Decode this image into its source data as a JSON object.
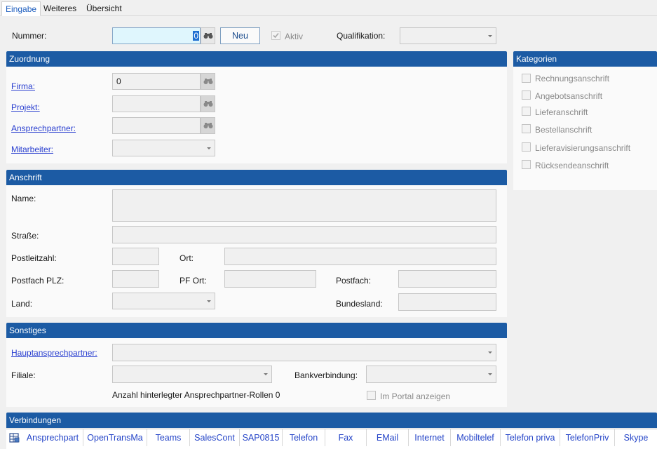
{
  "tabs": [
    {
      "label": "Eingabe"
    },
    {
      "label": "Weiteres"
    },
    {
      "label": "Übersicht"
    }
  ],
  "top": {
    "nummer_label": "Nummer:",
    "nummer_value": "0",
    "neu_label": "Neu",
    "aktiv_label": "Aktiv",
    "aktiv_checked": true,
    "qualifikation_label": "Qualifikation:",
    "qualifikation_value": ""
  },
  "zuordnung": {
    "title": "Zuordnung",
    "firma_label": "Firma:",
    "firma_value": "0",
    "projekt_label": "Projekt:",
    "projekt_value": "",
    "ansprechpartner_label": "Ansprechpartner:",
    "ansprechpartner_value": "",
    "mitarbeiter_label": "Mitarbeiter:",
    "mitarbeiter_value": ""
  },
  "kategorien": {
    "title": "Kategorien",
    "items": [
      {
        "label": "Rechnungsanschrift",
        "checked": false
      },
      {
        "label": "Angebotsanschrift",
        "checked": false
      },
      {
        "label": "Lieferanschrift",
        "checked": false
      },
      {
        "label": "Bestellanschrift",
        "checked": false
      },
      {
        "label": "Lieferavisierungsanschrift",
        "checked": false
      },
      {
        "label": "Rücksendeanschrift",
        "checked": false
      }
    ]
  },
  "anschrift": {
    "title": "Anschrift",
    "name_label": "Name:",
    "strasse_label": "Straße:",
    "plz_label": "Postleitzahl:",
    "ort_label": "Ort:",
    "pf_plz_label": "Postfach PLZ:",
    "pf_ort_label": "PF Ort:",
    "postfach_label": "Postfach:",
    "land_label": "Land:",
    "bundesland_label": "Bundesland:"
  },
  "sonstiges": {
    "title": "Sonstiges",
    "hauptansprechpartner_label": "Hauptansprechpartner:",
    "filiale_label": "Filiale:",
    "bankverbindung_label": "Bankverbindung:",
    "anzahl_text": "Anzahl hinterlegter Ansprechpartner-Rollen 0",
    "im_portal_label": "Im Portal anzeigen"
  },
  "verbindungen": {
    "title": "Verbindungen",
    "columns": [
      "Ansprechpart",
      "OpenTransMa",
      "Teams",
      "SalesCont",
      "SAP0815",
      "Telefon",
      "Fax",
      "EMail",
      "Internet",
      "Mobiltelef",
      "Telefon priva",
      "TelefonPriv",
      "Skype"
    ]
  },
  "colors": {
    "header_blue": "#1c5ba4",
    "link_blue": "#2a3fd0",
    "active_field": "#dff6fd"
  }
}
